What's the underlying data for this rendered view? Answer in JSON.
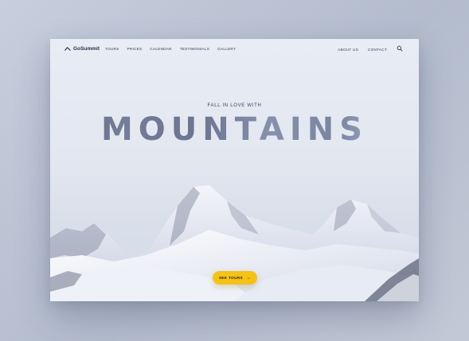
{
  "brand": {
    "name": "GoSummit"
  },
  "nav": {
    "left": [
      "TOURS",
      "PRICES",
      "CALENDAR",
      "TESTIMONIALS",
      "GALLERY"
    ],
    "right": [
      "ABOUT US",
      "CONTACT"
    ],
    "search_icon": "search-icon"
  },
  "hero": {
    "eyebrow": "FALL IN LOVE WITH",
    "title": "MOUNTAINS"
  },
  "cta": {
    "label": "SEE TOURS",
    "arrow": "→",
    "color": "#f5c218"
  },
  "colors": {
    "accent": "#f5c218",
    "text": "#1e2a44"
  }
}
